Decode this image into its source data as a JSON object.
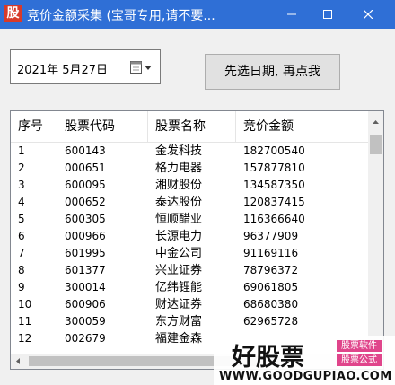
{
  "window": {
    "icon_char": "股",
    "title": "竞价金额采集  (宝哥专用,请不要..."
  },
  "date_picker": {
    "value": "2021年  5月27日"
  },
  "action_button": {
    "label": "先选日期, 再点我"
  },
  "table": {
    "headers": [
      "序号",
      "股票代码",
      "股票名称",
      "竞价金额"
    ],
    "rows": [
      [
        "1",
        "600143",
        "金发科技",
        "182700540"
      ],
      [
        "2",
        "000651",
        "格力电器",
        "157877810"
      ],
      [
        "3",
        "600095",
        "湘财股份",
        "134587350"
      ],
      [
        "4",
        "000652",
        "泰达股份",
        "120837415"
      ],
      [
        "5",
        "600305",
        "恒顺醋业",
        "116366640"
      ],
      [
        "6",
        "000966",
        "长源电力",
        "96377909"
      ],
      [
        "7",
        "601995",
        "中金公司",
        "91169116"
      ],
      [
        "8",
        "601377",
        "兴业证券",
        "78796372"
      ],
      [
        "9",
        "300014",
        "亿纬锂能",
        "69061805"
      ],
      [
        "10",
        "600906",
        "财达证券",
        "68680380"
      ],
      [
        "11",
        "300059",
        "东方财富",
        "62965728"
      ],
      [
        "12",
        "002679",
        "福建金森",
        ""
      ]
    ]
  },
  "watermark": {
    "brand": "好股票",
    "tag1": "股票软件",
    "tag2": "股票公式",
    "url": "WWW.GOODGUPIAO.COM"
  },
  "colors": {
    "titlebar": "#2f6fd6",
    "app_icon": "#d83a2a",
    "watermark_tag": "#e0458b"
  }
}
